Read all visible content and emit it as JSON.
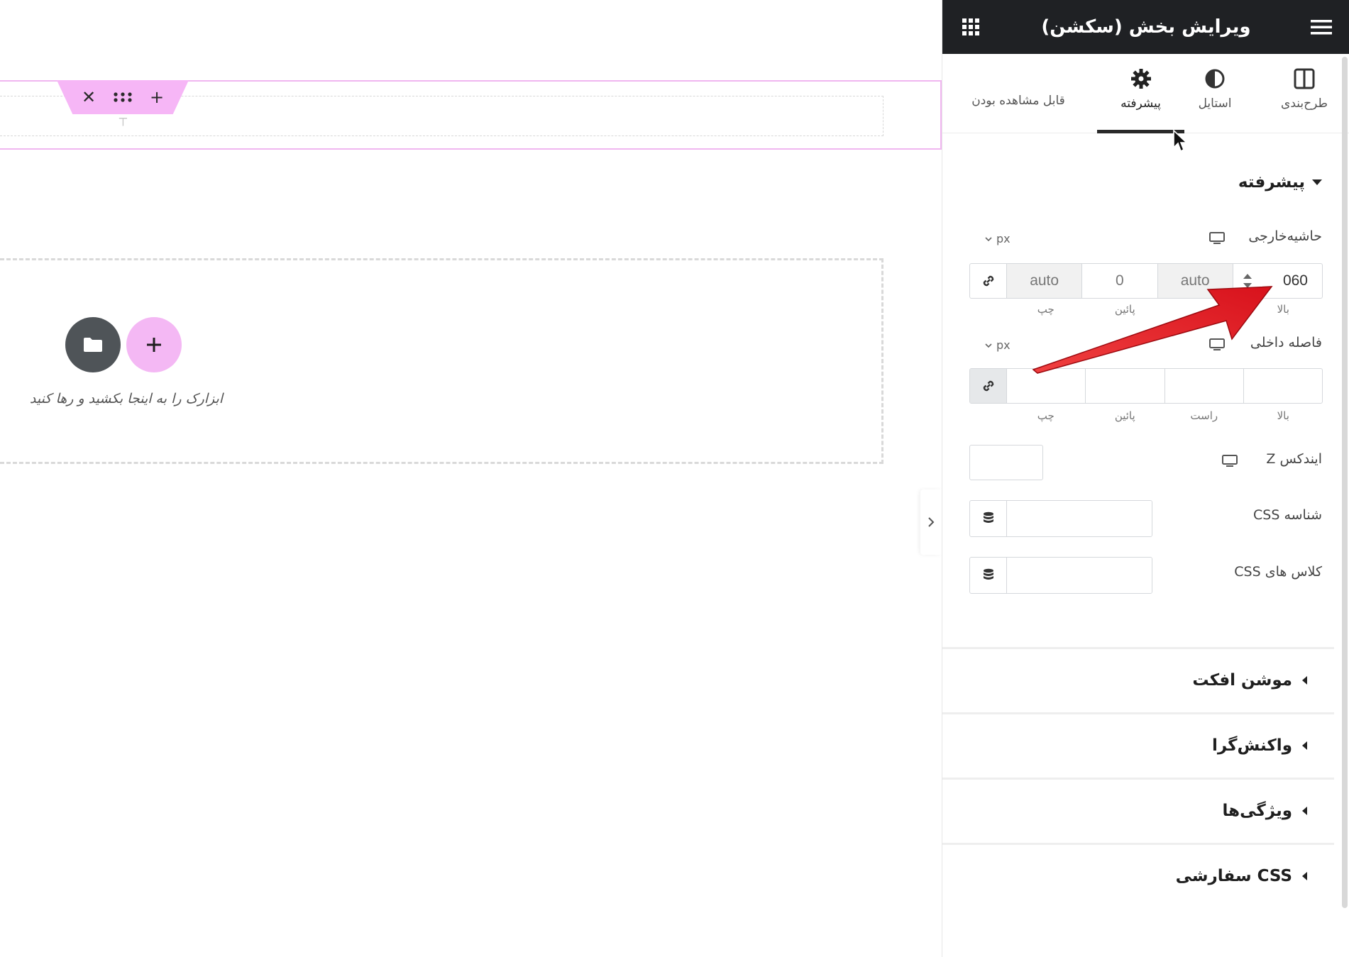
{
  "canvas": {
    "drop_text": "ابزارک را به اینجا بکشید و رها کنید",
    "section_handle": {
      "add": "+",
      "move": "⠿",
      "close": "✕"
    }
  },
  "panel": {
    "title": "ویرایش بخش (سکشن)",
    "tabs": [
      {
        "label": "طرح‌بندی",
        "icon": "layout-icon"
      },
      {
        "label": "استایل",
        "icon": "half-circle-icon"
      },
      {
        "label": "پیشرفته",
        "icon": "gear-icon",
        "active": true
      },
      {
        "label": "قابل مشاهده بودن"
      }
    ],
    "advanced": {
      "title": "پیشرفته",
      "margin": {
        "label": "حاشیه‌خارجی",
        "unit": "px",
        "values": {
          "top": "060",
          "right": "auto",
          "bottom": "0",
          "left": "auto"
        },
        "side_labels": {
          "top": "بالا",
          "bottom": "پائین",
          "left": "چپ"
        }
      },
      "padding": {
        "label": "فاصله داخلی",
        "unit": "px",
        "side_labels": {
          "top": "بالا",
          "right": "راست",
          "bottom": "پائین",
          "left": "چپ"
        }
      },
      "z_index": {
        "label": "ایندکس Z"
      },
      "css_id": {
        "label": "شناسه CSS"
      },
      "css_classes": {
        "label": "کلاس های CSS"
      }
    },
    "accordions": [
      "موشن افکت",
      "واکنش‌گرا",
      "ویژگی‌ها",
      "CSS سفارشی"
    ]
  },
  "colors": {
    "header_bg": "#1f2124",
    "accent_pink": "#f4b8f4",
    "annotation_red": "#e8202a"
  }
}
